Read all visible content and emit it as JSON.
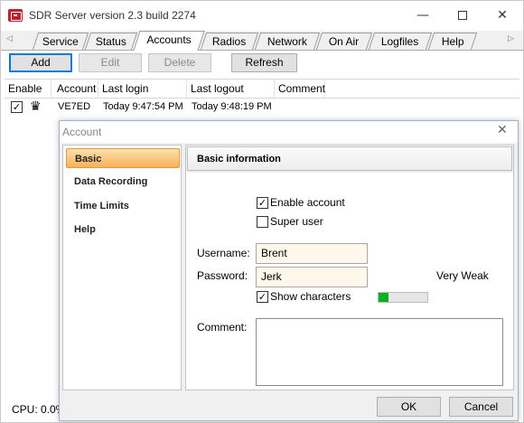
{
  "window": {
    "title": "SDR Server version 2.3 build 2274"
  },
  "tabs": [
    {
      "label": "Service"
    },
    {
      "label": "Status"
    },
    {
      "label": "Accounts"
    },
    {
      "label": "Radios"
    },
    {
      "label": "Network"
    },
    {
      "label": "On Air"
    },
    {
      "label": "Logfiles"
    },
    {
      "label": "Help"
    }
  ],
  "active_tab": "Accounts",
  "toolbar": {
    "add": "Add",
    "edit": "Edit",
    "delete": "Delete",
    "refresh": "Refresh"
  },
  "table": {
    "columns": [
      "Enable",
      "Account",
      "Last login",
      "Last logout",
      "Comment"
    ],
    "rows": [
      {
        "enabled": true,
        "account": "VE7ED",
        "last_login": "Today 9:47:54 PM",
        "last_logout": "Today 9:48:19 PM",
        "comment": ""
      }
    ]
  },
  "status": {
    "cpu": "CPU: 0.0%"
  },
  "dialog": {
    "title": "Account",
    "nav": [
      "Basic",
      "Data Recording",
      "Time Limits",
      "Help"
    ],
    "selected_nav": "Basic",
    "section_title": "Basic information",
    "enable_account": {
      "label": "Enable account",
      "checked": true
    },
    "super_user": {
      "label": "Super user",
      "checked": false
    },
    "username": {
      "label": "Username:",
      "value": "Brent"
    },
    "password": {
      "label": "Password:",
      "value": "Jerk",
      "strength": "Very Weak",
      "strength_level": 0.2
    },
    "show_characters": {
      "label": "Show characters",
      "checked": true
    },
    "comment": {
      "label": "Comment:",
      "value": ""
    },
    "ok": "OK",
    "cancel": "Cancel"
  },
  "colors": {
    "selected_nav": "#f8b15a",
    "strength_fill": "#06b025",
    "focus_border": "#0078d7"
  },
  "icons": {
    "app": "sdr-app-icon",
    "user_type": "crown-icon",
    "check": "checkmark-icon"
  }
}
